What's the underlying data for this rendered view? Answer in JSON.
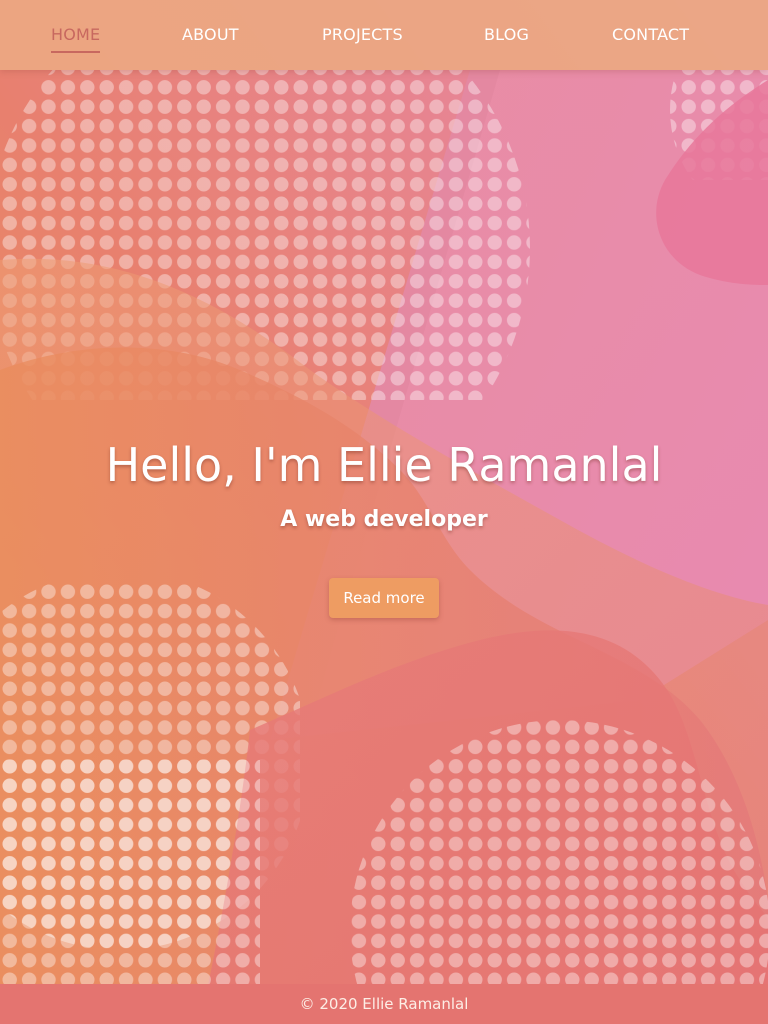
{
  "nav": {
    "items": [
      {
        "label": "HOME",
        "active": true
      },
      {
        "label": "ABOUT",
        "active": false
      },
      {
        "label": "PROJECTS",
        "active": false
      },
      {
        "label": "BLOG",
        "active": false
      },
      {
        "label": "CONTACT",
        "active": false
      }
    ]
  },
  "hero": {
    "title": "Hello, I'm Ellie Ramanlal",
    "subtitle": "A web developer",
    "cta_label": "Read more"
  },
  "footer": {
    "copyright": "© 2020 Ellie Ramanlal"
  },
  "colors": {
    "nav_background": "#eca882",
    "nav_active": "#c8685f",
    "button_background": "#ee9c62",
    "footer_background": "#e47470",
    "background_pink": "#e88ab0",
    "background_orange": "#ec9058",
    "background_coral": "#e57c6f"
  }
}
